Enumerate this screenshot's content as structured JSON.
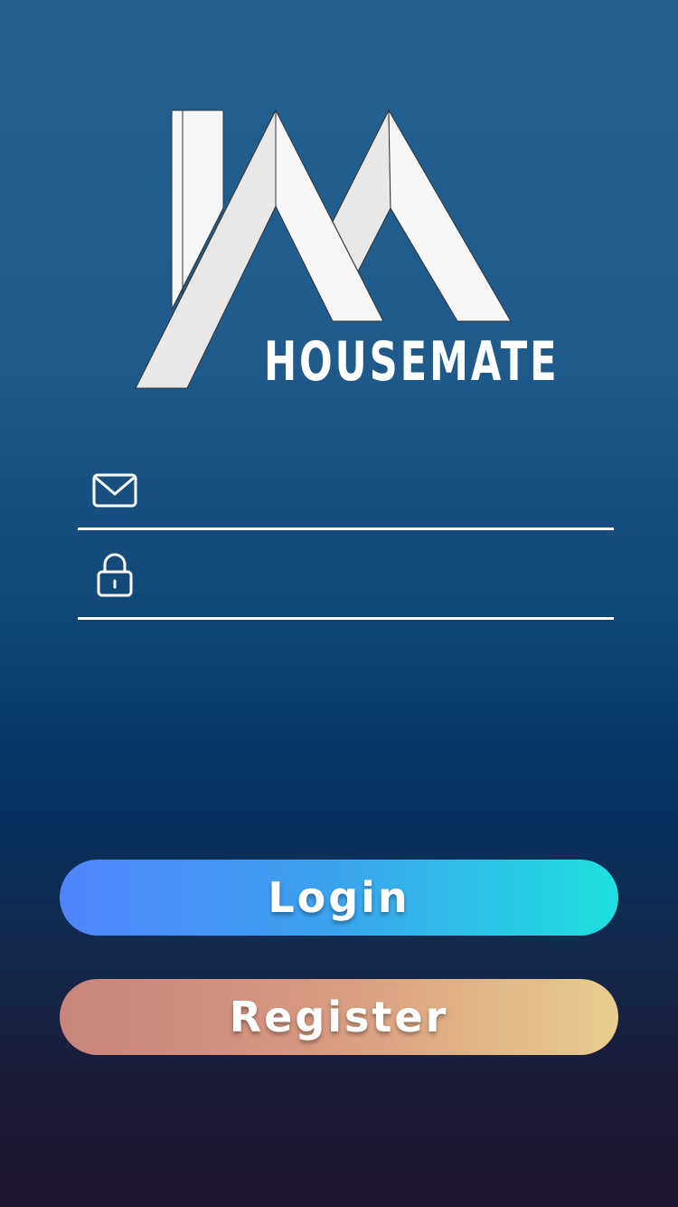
{
  "app": {
    "brand_name": "HOUSEMATE"
  },
  "form": {
    "email": {
      "icon": "envelope-icon",
      "value": "",
      "placeholder": ""
    },
    "password": {
      "icon": "lock-icon",
      "value": "",
      "placeholder": ""
    }
  },
  "actions": {
    "login_label": "Login",
    "register_label": "Register"
  },
  "colors": {
    "background_top": "#22618f",
    "background_bottom": "#1f1530",
    "login_gradient_start": "#5084fb",
    "login_gradient_end": "#1ee0df",
    "register_gradient_start": "#c9847c",
    "register_gradient_end": "#e9cd8d"
  }
}
